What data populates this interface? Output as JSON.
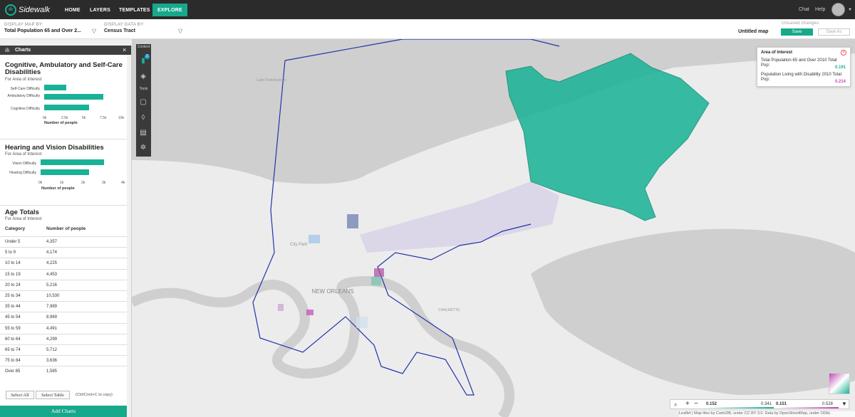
{
  "header": {
    "logo_text": "Sidewalk",
    "nav": [
      "HOME",
      "LAYERS",
      "TEMPLATES",
      "EXPLORE"
    ],
    "active_nav": "EXPLORE",
    "chat": "Chat",
    "help": "Help"
  },
  "display_bar": {
    "map_by_label": "DISPLAY MAP BY:",
    "map_by_value": "Total Population 65 and Over 2...",
    "data_by_label": "DISPLAY DATA BY:",
    "data_by_value": "Census Tract",
    "map_title": "Untitled map",
    "unsaved": "Unsaved changes",
    "save": "Save",
    "save_as": "Save As"
  },
  "charts_panel": {
    "title": "Charts",
    "cognitive": {
      "title": "Cognitive, Ambulatory and Self-Care Disabilities",
      "subtitle": "For Area of Interest",
      "xlabel": "Number of people",
      "ticks": [
        "0k",
        "2.5k",
        "5k",
        "7.5k",
        "10k"
      ],
      "categories": [
        "Self-Care Difficulty",
        "Ambulatory Difficulty",
        "Cognitive Difficulty"
      ],
      "values": [
        3200,
        8500,
        6400
      ],
      "xmax": 11000
    },
    "hearing": {
      "title": "Hearing and Vision Disabilities",
      "subtitle": "For Area of Interest",
      "xlabel": "Number of people",
      "ticks": [
        "0k",
        "1k",
        "2k",
        "3k",
        "4k"
      ],
      "categories": [
        "Vision Difficulty",
        "Hearing Difficulty"
      ],
      "values": [
        3000,
        2300
      ],
      "xmax": 4000
    },
    "age": {
      "title": "Age Totals",
      "subtitle": "For Area of Interest",
      "col_category": "Category",
      "col_number": "Number of people",
      "rows": [
        [
          "Under 5",
          "4,357"
        ],
        [
          "5 to 9",
          "4,174"
        ],
        [
          "10 to 14",
          "4,225"
        ],
        [
          "15 to 19",
          "4,453"
        ],
        [
          "20 to 24",
          "5,216"
        ],
        [
          "25 to 34",
          "10,530"
        ],
        [
          "35 to 44",
          "7,989"
        ],
        [
          "45 to 54",
          "8,969"
        ],
        [
          "55 to 59",
          "4,491"
        ],
        [
          "60 to 64",
          "4,299"
        ],
        [
          "65 to 74",
          "5,712"
        ],
        [
          "75 to 84",
          "3,636"
        ],
        [
          "Over 85",
          "1,585"
        ]
      ],
      "select_all": "Select All",
      "select_table": "Select Table",
      "copy_hint": "(Ctrl/Cmd+C to copy)"
    },
    "add_charts": "Add Charts"
  },
  "toolbar": {
    "content": "Content",
    "tools": "Tools",
    "badge": "2"
  },
  "aoi_popup": {
    "title": "Area of Interest",
    "line1": "Total Population 65 and Over 2010 Total Pop:",
    "value1": "0.191",
    "line2": "Population Living with Disability 2010 Total Pop:",
    "value2": "0.214"
  },
  "map_labels": {
    "city": "NEW ORLEANS",
    "city_park": "City Park",
    "lake_lbl": "Lake Pontchartrain",
    "chalmette": "CHALMETTE"
  },
  "legend": {
    "min1": "0.152",
    "max1": "0.341",
    "min2": "0.151",
    "max2": "0.528"
  },
  "attribution": "Leaflet | Map tiles by CartoDB, under CC BY 3.0. Data by OpenStreetMap, under ODbL"
}
